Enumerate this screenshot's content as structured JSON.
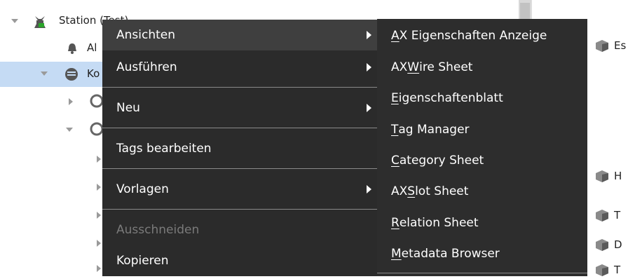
{
  "tree": {
    "rows": [
      {
        "label": "Station (Test)"
      },
      {
        "label": "Al"
      },
      {
        "label": "Ko"
      }
    ]
  },
  "right_pane": {
    "items": [
      "Es",
      "H",
      "T",
      "D",
      "T"
    ]
  },
  "context_menu": {
    "items": [
      {
        "label": "Ansichten",
        "submenu": true,
        "hover": true
      },
      {
        "label": "Ausführen",
        "submenu": true
      },
      {
        "label": "Neu",
        "submenu": true
      },
      {
        "label": "Tags bearbeiten"
      },
      {
        "label": "Vorlagen",
        "submenu": true
      },
      {
        "label": "Ausschneiden",
        "disabled": true
      },
      {
        "label": "Kopieren"
      }
    ]
  },
  "submenu": {
    "items": [
      {
        "pre": "",
        "u": "A",
        "post": "X Eigenschaften Anzeige"
      },
      {
        "pre": "AX ",
        "u": "W",
        "post": "ire Sheet"
      },
      {
        "pre": "",
        "u": "E",
        "post": "igenschaftenblatt"
      },
      {
        "pre": "",
        "u": "T",
        "post": "ag Manager"
      },
      {
        "pre": "",
        "u": "C",
        "post": "ategory Sheet"
      },
      {
        "pre": "AX ",
        "u": "S",
        "post": "lot Sheet"
      },
      {
        "pre": "",
        "u": "R",
        "post": "elation Sheet"
      },
      {
        "pre": "",
        "u": "M",
        "post": "etadata Browser"
      }
    ]
  }
}
